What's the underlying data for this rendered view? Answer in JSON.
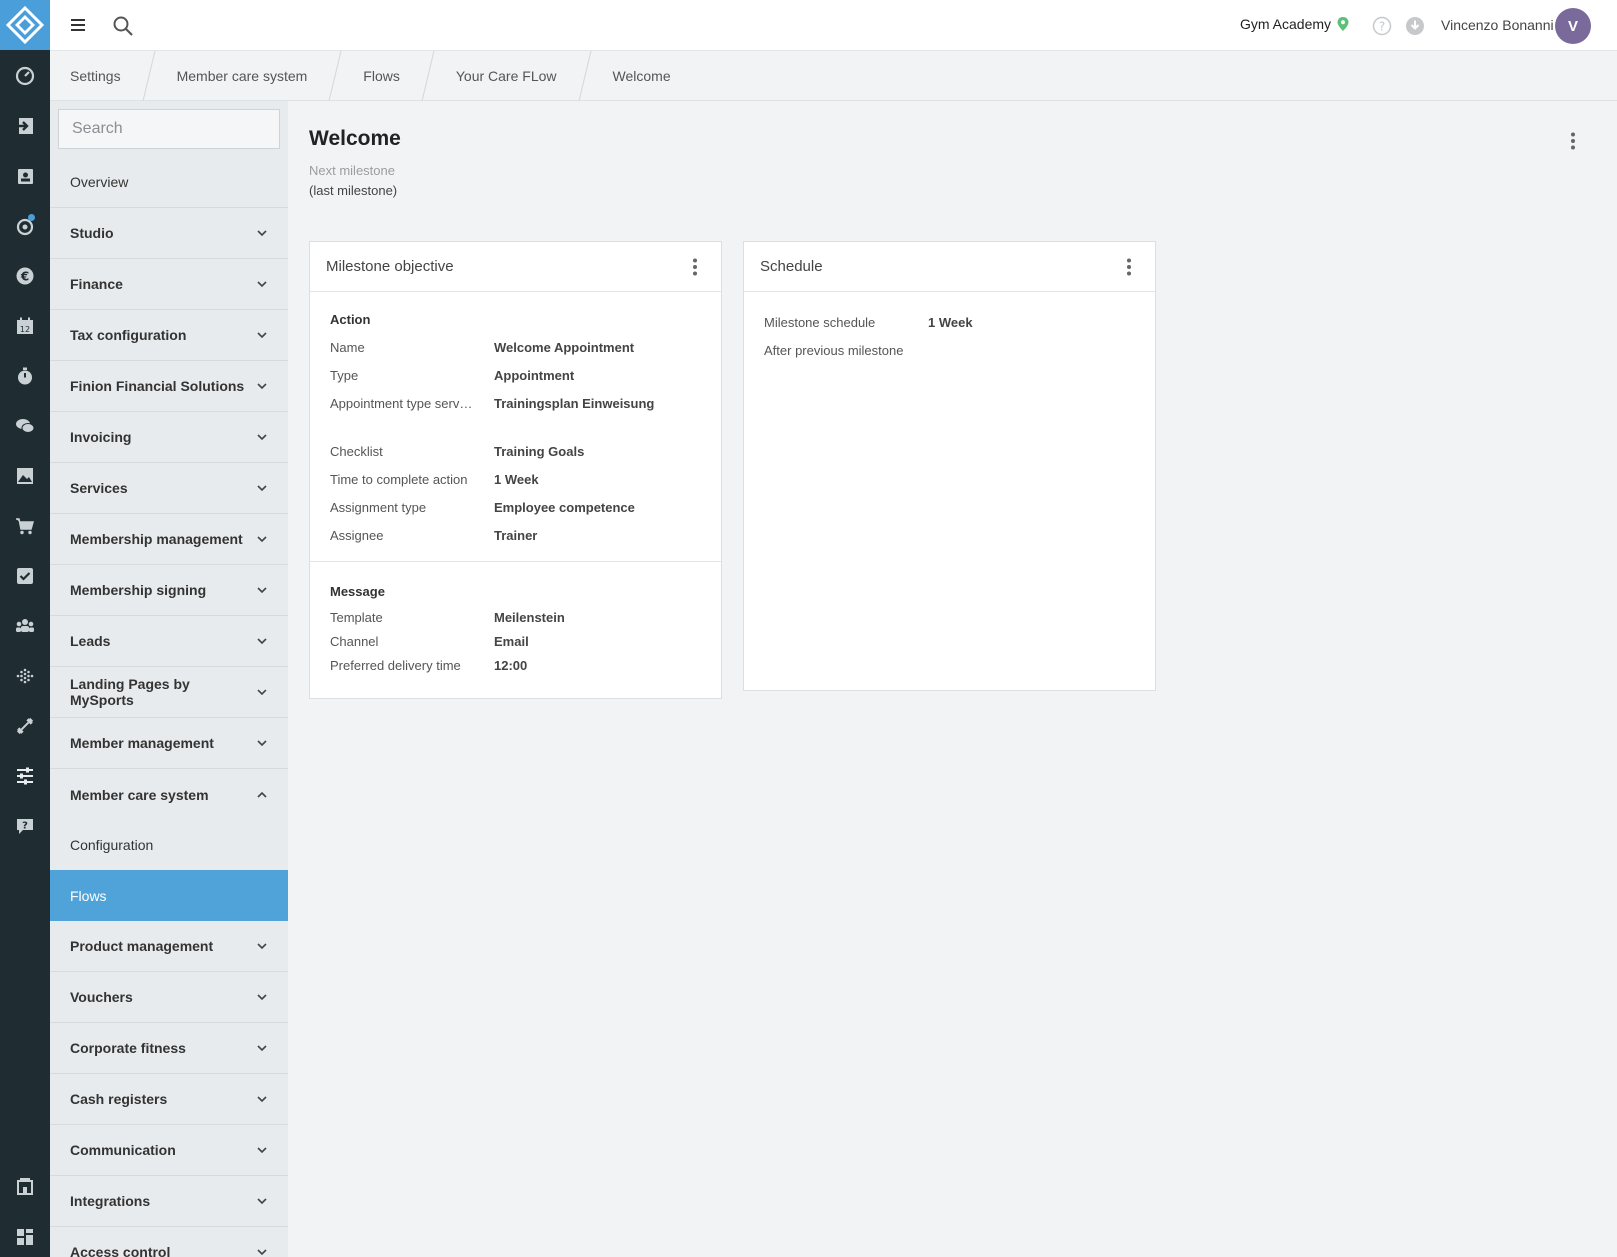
{
  "topbar": {
    "studio": "Gym Academy",
    "username": "Vincenzo Bonanni",
    "avatar_initial": "V"
  },
  "breadcrumb": [
    "Settings",
    "Member care system",
    "Flows",
    "Your Care FLow",
    "Welcome"
  ],
  "sidebar": {
    "search_placeholder": "Search",
    "items": [
      {
        "label": "Overview"
      },
      {
        "label": "Studio"
      },
      {
        "label": "Finance"
      },
      {
        "label": "Tax configuration"
      },
      {
        "label": "Finion Financial Solutions"
      },
      {
        "label": "Invoicing"
      },
      {
        "label": "Services"
      },
      {
        "label": "Membership management"
      },
      {
        "label": "Membership signing"
      },
      {
        "label": "Leads"
      },
      {
        "label": "Landing Pages by MySports"
      },
      {
        "label": "Member management"
      },
      {
        "label": "Member care system"
      },
      {
        "label": "Configuration"
      },
      {
        "label": "Flows"
      },
      {
        "label": "Product management"
      },
      {
        "label": "Vouchers"
      },
      {
        "label": "Corporate fitness"
      },
      {
        "label": "Cash registers"
      },
      {
        "label": "Communication"
      },
      {
        "label": "Integrations"
      },
      {
        "label": "Access control"
      }
    ]
  },
  "main": {
    "title": "Welcome",
    "next_milestone_label": "Next milestone",
    "next_milestone_value": "(last milestone)"
  },
  "objective": {
    "title": "Milestone objective",
    "action_title": "Action",
    "action_rows": [
      {
        "label": "Name",
        "value": "Welcome Appointment"
      },
      {
        "label": "Type",
        "value": "Appointment"
      },
      {
        "label": "Appointment type serv…",
        "value": "Trainingsplan Einweisung"
      }
    ],
    "action_rows2": [
      {
        "label": "Checklist",
        "value": "Training Goals"
      },
      {
        "label": "Time to complete action",
        "value": "1 Week"
      },
      {
        "label": "Assignment type",
        "value": "Employee competence"
      },
      {
        "label": "Assignee",
        "value": "Trainer"
      }
    ],
    "message_title": "Message",
    "message_rows": [
      {
        "label": "Template",
        "value": "Meilenstein"
      },
      {
        "label": "Channel",
        "value": "Email"
      },
      {
        "label": "Preferred delivery time",
        "value": "12:00"
      }
    ]
  },
  "schedule": {
    "title": "Schedule",
    "rows": [
      {
        "label": "Milestone schedule",
        "value": "1 Week"
      },
      {
        "label": "After previous milestone",
        "value": ""
      }
    ]
  },
  "rail_icons": [
    "dashboard-icon",
    "check-in-icon",
    "contacts-icon",
    "member-care-icon",
    "finance-icon",
    "calendar-icon",
    "timer-icon",
    "chat-icon",
    "gallery-icon",
    "shop-icon",
    "tasks-icon",
    "members-icon",
    "analytics-icon",
    "equipment-icon",
    "settings-icon",
    "support-icon",
    "store-icon",
    "apps-icon"
  ],
  "colors": {
    "accent": "#4fa3d9",
    "rail": "#1f2d33",
    "avatar": "#7a6a9c",
    "location_pin": "#5cc07a"
  }
}
